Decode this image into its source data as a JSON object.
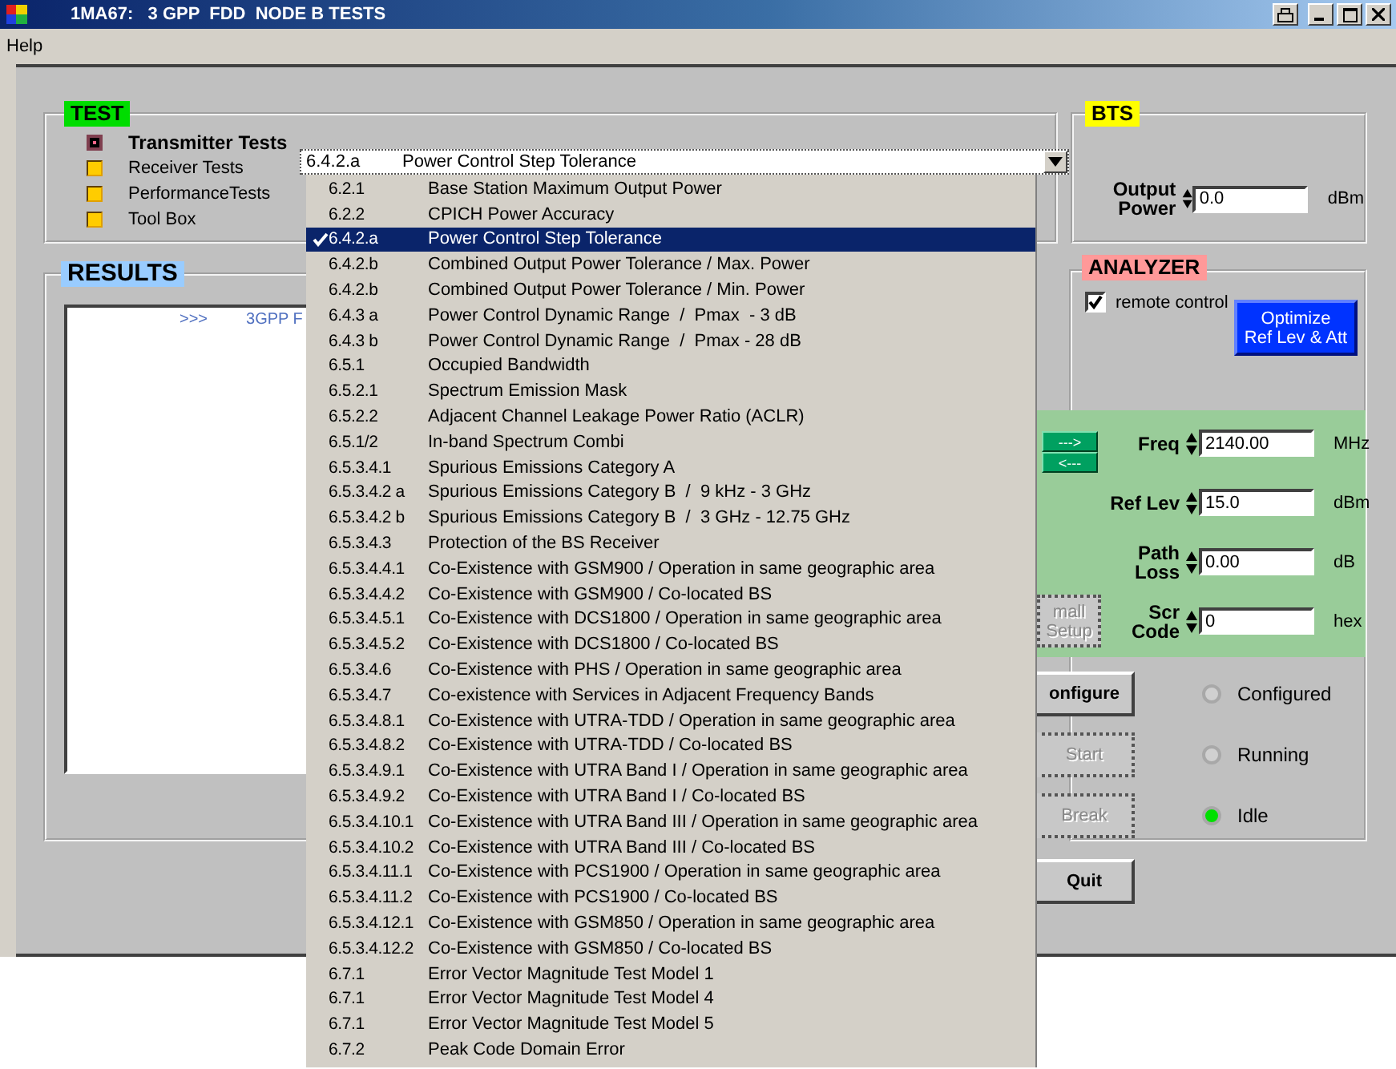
{
  "window": {
    "title": "1MA67:   3 GPP  FDD  NODE B TESTS"
  },
  "menu": [
    "Help"
  ],
  "test": {
    "legend": "TEST",
    "categories": [
      {
        "label": "Transmitter Tests",
        "selected": true
      },
      {
        "label": "Receiver Tests",
        "selected": false
      },
      {
        "label": "PerformanceTests",
        "selected": false
      },
      {
        "label": "Tool Box",
        "selected": false
      }
    ]
  },
  "test_select": {
    "code": "6.4.2.a",
    "name": "Power Control Step Tolerance",
    "expanded": true,
    "options": [
      {
        "code": "6.2.1",
        "name": "Base Station Maximum Output Power",
        "selected": false
      },
      {
        "code": "6.2.2",
        "name": "CPICH Power Accuracy",
        "selected": false
      },
      {
        "code": "6.4.2.a",
        "name": "Power Control Step Tolerance",
        "selected": true
      },
      {
        "code": "6.4.2.b",
        "name": "Combined Output Power Tolerance / Max. Power",
        "selected": false
      },
      {
        "code": "6.4.2.b",
        "name": "Combined Output Power Tolerance / Min. Power",
        "selected": false
      },
      {
        "code": "6.4.3 a",
        "name": "Power Control Dynamic Range  /  Pmax  - 3 dB",
        "selected": false
      },
      {
        "code": "6.4.3 b",
        "name": "Power Control Dynamic Range  /  Pmax - 28 dB",
        "selected": false
      },
      {
        "code": "6.5.1",
        "name": "Occupied Bandwidth",
        "selected": false
      },
      {
        "code": "6.5.2.1",
        "name": "Spectrum Emission Mask",
        "selected": false
      },
      {
        "code": "6.5.2.2",
        "name": "Adjacent Channel Leakage Power Ratio (ACLR)",
        "selected": false
      },
      {
        "code": "6.5.1/2",
        "name": "In-band Spectrum Combi",
        "selected": false
      },
      {
        "code": "6.5.3.4.1",
        "name": "Spurious Emissions Category A",
        "selected": false
      },
      {
        "code": "6.5.3.4.2 a",
        "name": "Spurious Emissions Category B  /  9 kHz - 3 GHz",
        "selected": false
      },
      {
        "code": "6.5.3.4.2 b",
        "name": "Spurious Emissions Category B  /  3 GHz - 12.75 GHz",
        "selected": false
      },
      {
        "code": "6.5.3.4.3",
        "name": "Protection of the BS Receiver",
        "selected": false
      },
      {
        "code": "6.5.3.4.4.1",
        "name": "Co-Existence with GSM900 / Operation in same geographic area",
        "selected": false
      },
      {
        "code": "6.5.3.4.4.2",
        "name": "Co-Existence with GSM900 / Co-located BS",
        "selected": false
      },
      {
        "code": "6.5.3.4.5.1",
        "name": "Co-Existence with DCS1800 / Operation in same geographic area",
        "selected": false
      },
      {
        "code": "6.5.3.4.5.2",
        "name": "Co-Existence with DCS1800 / Co-located BS",
        "selected": false
      },
      {
        "code": "6.5.3.4.6",
        "name": "Co-Existence with PHS / Operation in same geographic area",
        "selected": false
      },
      {
        "code": "6.5.3.4.7",
        "name": "Co-existence with Services in Adjacent Frequency Bands",
        "selected": false
      },
      {
        "code": "6.5.3.4.8.1",
        "name": "Co-Existence with UTRA-TDD / Operation in same geographic area",
        "selected": false
      },
      {
        "code": "6.5.3.4.8.2",
        "name": "Co-Existence with UTRA-TDD / Co-located BS",
        "selected": false
      },
      {
        "code": "6.5.3.4.9.1",
        "name": "Co-Existence with UTRA Band I / Operation in same geographic area",
        "selected": false
      },
      {
        "code": "6.5.3.4.9.2",
        "name": "Co-Existence with UTRA Band I / Co-located BS",
        "selected": false
      },
      {
        "code": "6.5.3.4.10.1",
        "name": "Co-Existence with UTRA Band III / Operation in same geographic area",
        "selected": false
      },
      {
        "code": "6.5.3.4.10.2",
        "name": "Co-Existence with UTRA Band III / Co-located BS",
        "selected": false
      },
      {
        "code": "6.5.3.4.11.1",
        "name": "Co-Existence with PCS1900 / Operation in same geographic area",
        "selected": false
      },
      {
        "code": "6.5.3.4.11.2",
        "name": "Co-Existence with PCS1900 / Co-located BS",
        "selected": false
      },
      {
        "code": "6.5.3.4.12.1",
        "name": "Co-Existence with GSM850 / Operation in same geographic area",
        "selected": false
      },
      {
        "code": "6.5.3.4.12.2",
        "name": "Co-Existence with GSM850 / Co-located BS",
        "selected": false
      },
      {
        "code": "6.7.1",
        "name": "Error Vector Magnitude Test Model 1",
        "selected": false
      },
      {
        "code": "6.7.1",
        "name": "Error Vector Magnitude Test Model 4",
        "selected": false
      },
      {
        "code": "6.7.1",
        "name": "Error Vector Magnitude Test Model 5",
        "selected": false
      },
      {
        "code": "6.7.2",
        "name": "Peak Code Domain Error",
        "selected": false
      }
    ]
  },
  "results": {
    "legend": "RESULTS",
    "lines": [
      {
        "prompt": ">>>",
        "text": "3GPP F"
      }
    ]
  },
  "bts": {
    "legend": "BTS",
    "output_power": {
      "label": "Output Power",
      "value": "0.0",
      "unit": "dBm"
    }
  },
  "analyzer": {
    "legend": "ANALYZER",
    "remote_control": {
      "label": "remote control",
      "checked": true
    },
    "optimize_button": "Optimize\nRef Lev  &  Att",
    "transfer_buttons": [
      "--->",
      "<---"
    ],
    "setup_button": {
      "label": "mall\nSetup",
      "disabled": true
    },
    "fields": [
      {
        "label": "Freq",
        "value": "2140.00",
        "unit": "MHz"
      },
      {
        "label": "Ref Lev",
        "value": "15.0",
        "unit": "dBm"
      },
      {
        "label": "Path\nLoss",
        "value": "0.00",
        "unit": "dB"
      },
      {
        "label": "Scr\nCode",
        "value": "0",
        "unit": "hex"
      }
    ]
  },
  "controls": [
    {
      "label": "onfigure",
      "disabled": false
    },
    {
      "label": "Start",
      "disabled": true
    },
    {
      "label": "Break",
      "disabled": true
    }
  ],
  "status": [
    {
      "label": "Configured",
      "on": false
    },
    {
      "label": "Running",
      "on": false
    },
    {
      "label": "Idle",
      "on": true
    }
  ],
  "quit_button": {
    "label": "Quit",
    "disabled": false
  }
}
